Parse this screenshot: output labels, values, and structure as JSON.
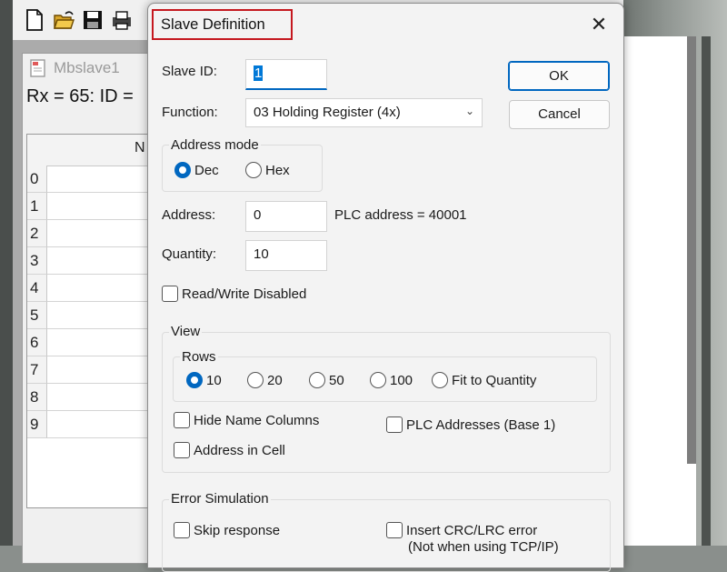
{
  "app": {
    "child_window_title": "Mbslave1",
    "status_line": "Rx = 65: ID =",
    "grid": {
      "header": "N",
      "row_numbers": [
        "0",
        "1",
        "2",
        "3",
        "4",
        "5",
        "6",
        "7",
        "8",
        "9"
      ]
    }
  },
  "dialog": {
    "title": "Slave Definition",
    "close_glyph": "✕",
    "slave_id": {
      "label": "Slave ID:",
      "value": "1"
    },
    "function": {
      "label": "Function:",
      "value": "03 Holding Register (4x)"
    },
    "address_mode": {
      "label": "Address mode",
      "options": [
        {
          "label": "Dec",
          "selected": true
        },
        {
          "label": "Hex",
          "selected": false
        }
      ]
    },
    "address": {
      "label": "Address:",
      "value": "0",
      "plc_note": "PLC address = 40001"
    },
    "quantity": {
      "label": "Quantity:",
      "value": "10"
    },
    "rw_disabled": {
      "label": "Read/Write Disabled",
      "checked": false
    },
    "view": {
      "label": "View",
      "rows_label": "Rows",
      "rows_options": [
        {
          "label": "10",
          "selected": true
        },
        {
          "label": "20",
          "selected": false
        },
        {
          "label": "50",
          "selected": false
        },
        {
          "label": "100",
          "selected": false
        },
        {
          "label": "Fit to Quantity",
          "selected": false
        }
      ],
      "hide_name_columns": {
        "label": "Hide Name Columns",
        "checked": false
      },
      "plc_addresses": {
        "label": "PLC Addresses (Base 1)",
        "checked": false
      },
      "address_in_cell": {
        "label": "Address in Cell",
        "checked": false
      }
    },
    "error_simulation": {
      "label": "Error Simulation",
      "skip_response": {
        "label": "Skip response",
        "checked": false
      },
      "insert_crc": {
        "label": "Insert CRC/LRC error",
        "checked": false
      },
      "insert_crc_note": "(Not when using TCP/IP)"
    },
    "buttons": {
      "ok": "OK",
      "cancel": "Cancel"
    }
  },
  "colors": {
    "accent": "#0067c0",
    "title_highlight": "#c5181f"
  }
}
